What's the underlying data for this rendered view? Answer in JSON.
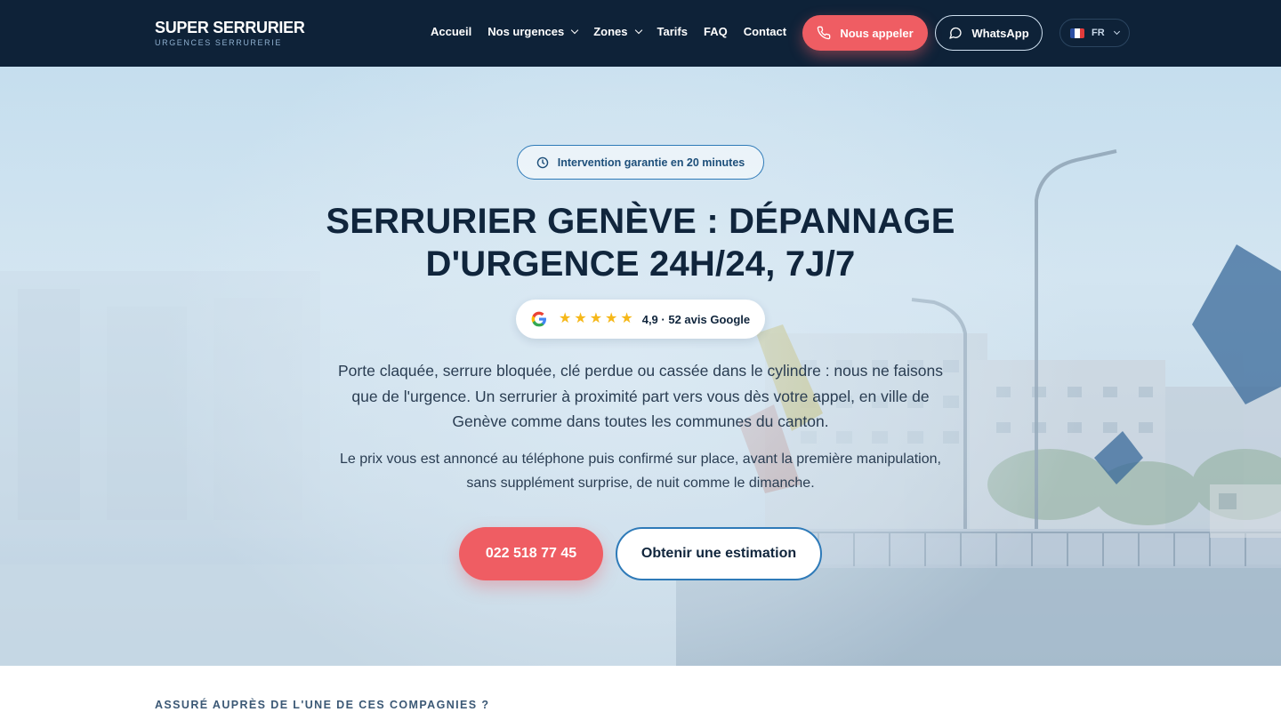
{
  "nav": {
    "brand_title": "SUPER SERRURIER",
    "brand_subtitle": "URGENCES SERRURERIE",
    "menu": [
      {
        "label": "Accueil",
        "has_dropdown": false
      },
      {
        "label": "Nos urgences",
        "has_dropdown": true
      },
      {
        "label": "Zones",
        "has_dropdown": true
      },
      {
        "label": "Tarifs",
        "has_dropdown": false
      },
      {
        "label": "FAQ",
        "has_dropdown": false
      },
      {
        "label": "Contact",
        "has_dropdown": false
      }
    ],
    "call_button": "Nous appeler",
    "whatsapp_button": "WhatsApp",
    "language": "FR"
  },
  "hero": {
    "badge": "Intervention garantie en 20 minutes",
    "title": "SERRURIER GENÈVE : DÉPANNAGE D'URGENCE 24H/24, 7J/7",
    "rating": {
      "stars": 5,
      "text": "4,9 · 52 avis Google"
    },
    "paragraph_1": "Porte claquée, serrure bloquée, clé perdue ou cassée dans le cylindre : nous ne faisons que de l'urgence. Un serrurier à proximité part vers vous dès votre appel, en ville de Genève comme dans toutes les communes du canton.",
    "paragraph_2": "Le prix vous est annoncé au téléphone puis confirmé sur place, avant la première manipulation, sans supplément surprise, de nuit comme le dimanche.",
    "phone_button": "022 518 77 45",
    "estimate_button": "Obtenir une estimation"
  },
  "insurance": {
    "heading": "ASSURÉ AUPRÈS DE L'UNE DE CES COMPAGNIES ?"
  },
  "colors": {
    "nav_bg": "#0e2238",
    "accent": "#ef5d63",
    "outline_blue": "#2e7ab8",
    "star": "#f6b819"
  },
  "icons": {
    "call": "phone-icon",
    "whatsapp": "chat-bubble-icon",
    "language": "france-flag-icon",
    "badge": "clock-icon",
    "rating": "google-g-icon"
  }
}
